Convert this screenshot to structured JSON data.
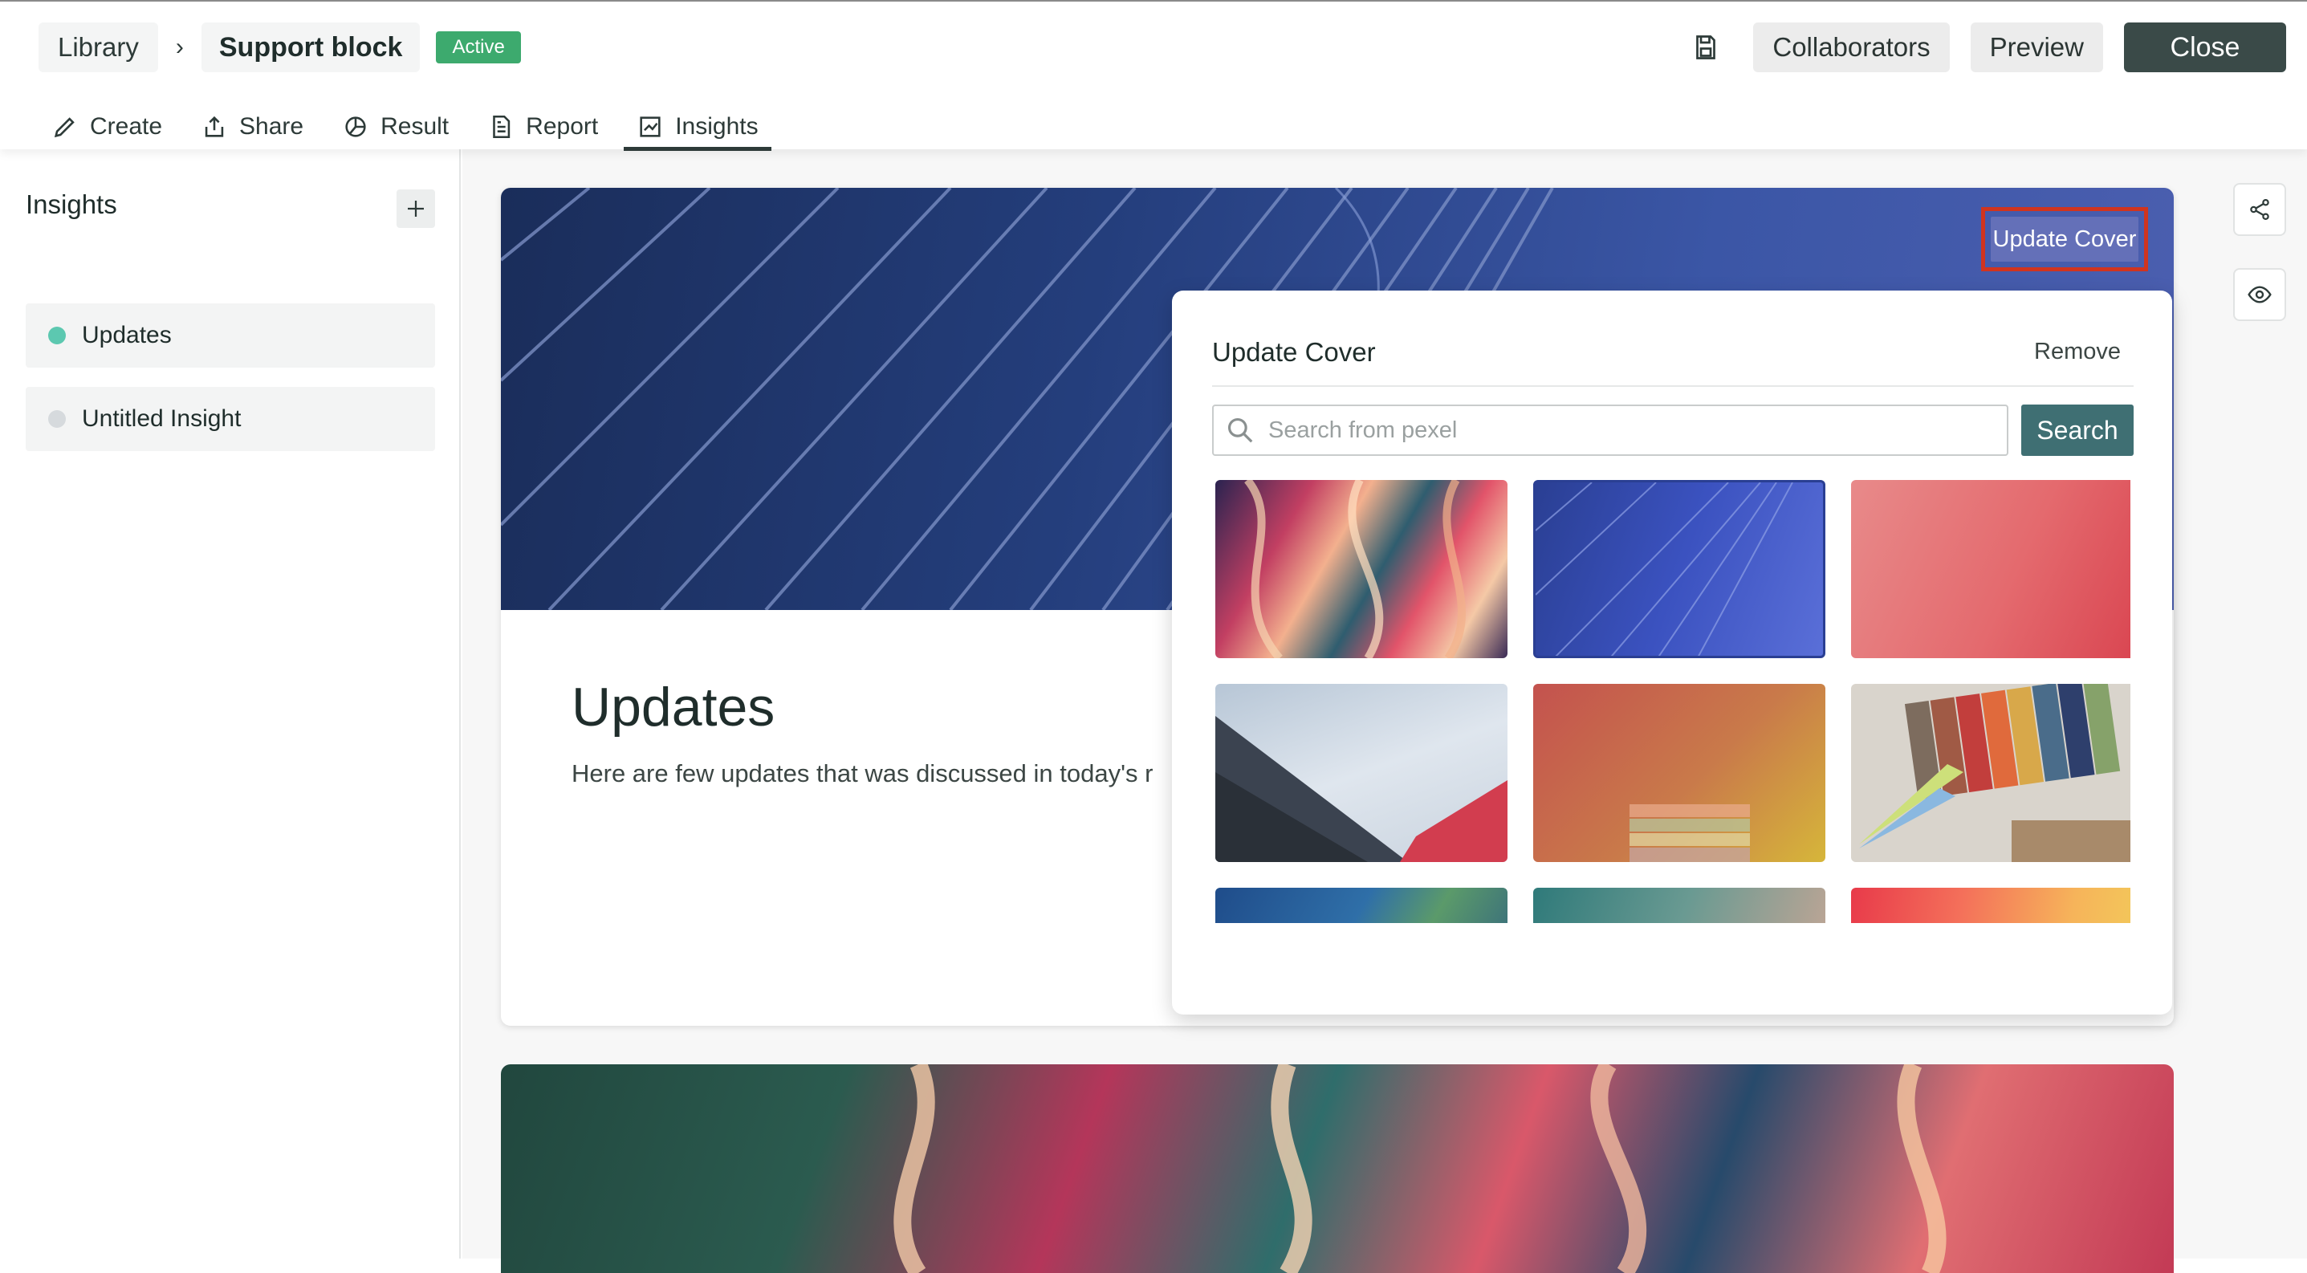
{
  "header": {
    "breadcrumb": {
      "library": "Library",
      "separator": "›",
      "current": "Support block"
    },
    "status_badge": "Active",
    "actions": {
      "collaborators": "Collaborators",
      "preview": "Preview",
      "close": "Close"
    }
  },
  "tabs": [
    {
      "label": "Create",
      "icon": "pencil-icon"
    },
    {
      "label": "Share",
      "icon": "share-upload-icon"
    },
    {
      "label": "Result",
      "icon": "pie-chart-icon"
    },
    {
      "label": "Report",
      "icon": "document-icon"
    },
    {
      "label": "Insights",
      "icon": "line-chart-icon",
      "active": true
    }
  ],
  "sidebar": {
    "title": "Insights",
    "items": [
      {
        "label": "Updates",
        "dot_color": "#5cc8b0"
      },
      {
        "label": "Untitled Insight",
        "dot_color": "#d6dadd"
      }
    ]
  },
  "insight_card": {
    "title": "Updates",
    "description": "Here are few updates that was discussed in today's r",
    "update_cover_button": "Update Cover"
  },
  "cover_popover": {
    "title": "Update Cover",
    "remove_label": "Remove",
    "search_placeholder": "Search from pexel",
    "search_button": "Search",
    "thumbnails": [
      "abstract-marble-pink-thumbnail",
      "blue-lines-thumbnail",
      "red-gradient-thumbnail",
      "building-sky-thumbnail",
      "orange-stairs-thumbnail",
      "fabric-swatches-thumbnail",
      "blue-paint-thumbnail",
      "teal-gradient-thumbnail",
      "sunset-gradient-thumbnail"
    ]
  },
  "colors": {
    "accent_dark": "#3a4a48",
    "badge_green": "#3daa6e",
    "search_button": "#3f6f73",
    "highlight_red": "#d0341f"
  }
}
